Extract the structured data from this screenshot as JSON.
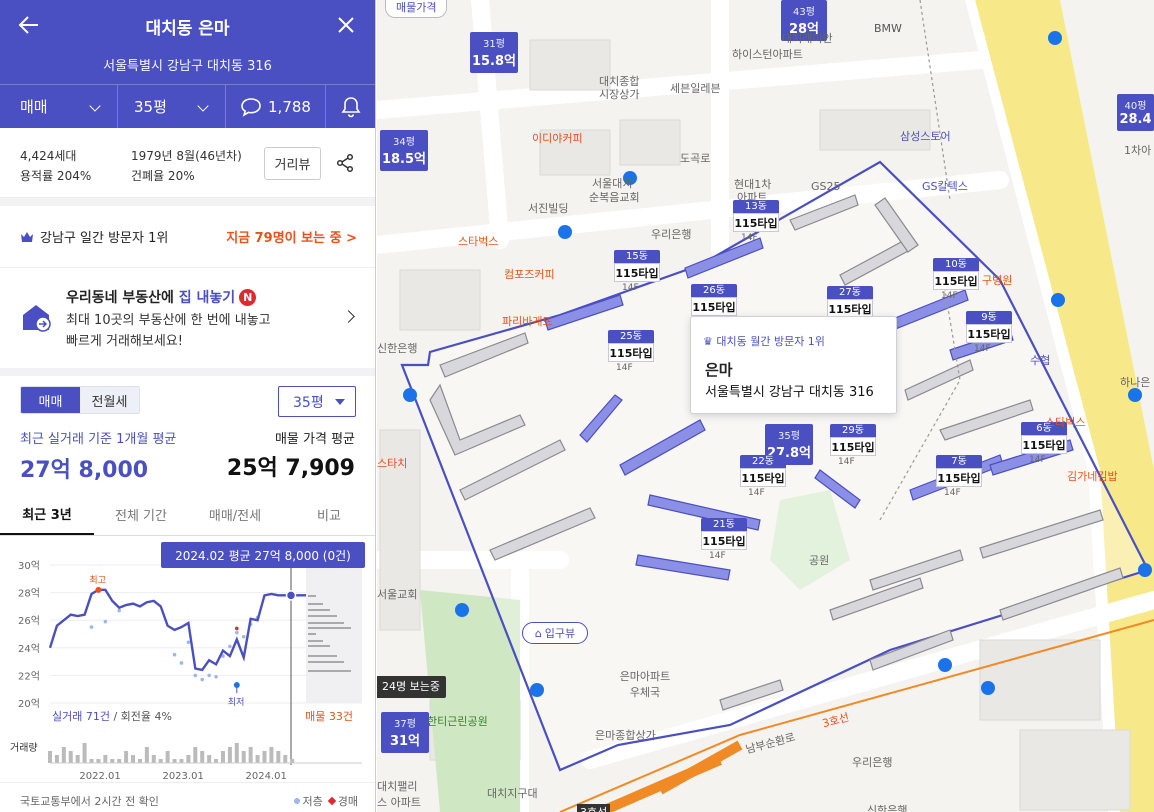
{
  "header": {
    "title": "대치동 은마",
    "address": "서울특별시 강남구 대치동 316",
    "trade_type": "매매",
    "area": "35평",
    "comment_count": "1,788"
  },
  "info": {
    "households": "4,424세대",
    "floor_area_ratio": "용적률 204%",
    "built": "1979년 8월(46년차)",
    "coverage_ratio": "건폐율 20%",
    "street_view": "거리뷰"
  },
  "visit": {
    "rank": "강남구 일간 방문자 1위",
    "now": "지금 79명이 보는 중 >"
  },
  "promo": {
    "title_a": "우리동네 부동산에 ",
    "title_b": "집 내놓기",
    "badge": "N",
    "desc1": "최대 10곳의 부동산에 한 번에 내놓고",
    "desc2": "빠르게 거래해보세요!"
  },
  "trade": {
    "toggle": [
      "매매",
      "전월세"
    ],
    "size": "35평",
    "recent_label": "최근 실거래 기준 1개월 평균",
    "recent_value": "27억 8,000",
    "listing_label": "매물 가격 평균",
    "listing_value": "25억 7,909"
  },
  "tabs": [
    "최근 3년",
    "전체 기간",
    "매매/전세",
    "비교"
  ],
  "chart_tooltip": "2024.02 평균 27억 8,000 (0건)",
  "chart_legend": {
    "deals": "실거래 71건",
    "turnover": " / 회전율 4%",
    "listings": "매물 33건",
    "volume": "거래량",
    "high": "최고",
    "low": "최저"
  },
  "chart_data": {
    "type": "line",
    "ylabel": "",
    "ylim": [
      20,
      30
    ],
    "yticks": [
      "30억",
      "28억",
      "26억",
      "24억",
      "22억",
      "20억"
    ],
    "xticks": [
      "2022.01",
      "2023.01",
      "2024.01"
    ],
    "series": [
      {
        "name": "실거래",
        "x": [
          0,
          1,
          2,
          3,
          4,
          5,
          6,
          7,
          8,
          9,
          10,
          11,
          12,
          13,
          14,
          15,
          16,
          17,
          18,
          19,
          20,
          21,
          22,
          23,
          24,
          25,
          26,
          27,
          28,
          29,
          30,
          31,
          32,
          33,
          34,
          35,
          36,
          37
        ],
        "values": [
          24.0,
          25.6,
          26.0,
          26.4,
          26.3,
          26.4,
          27.9,
          28.2,
          28.2,
          27.4,
          26.9,
          27.1,
          27.2,
          27.0,
          27.3,
          27.4,
          27.0,
          25.6,
          25.3,
          25.5,
          25.8,
          22.5,
          22.4,
          23.1,
          22.8,
          23.8,
          23.4,
          24.6,
          23.3,
          26.1,
          26.0,
          27.8,
          27.9,
          27.8,
          27.8,
          27.8,
          27.8,
          27.8
        ]
      }
    ],
    "high": 28.2,
    "low": 21.3,
    "volume": [
      3,
      2,
      4,
      3,
      2,
      5,
      1,
      1,
      2,
      1,
      1,
      3,
      2,
      1,
      4,
      2,
      1,
      3,
      1,
      1,
      2,
      4,
      3,
      2,
      1,
      3,
      4,
      5,
      3,
      4,
      2,
      3,
      4,
      3,
      2,
      1,
      0,
      0
    ]
  },
  "footer": {
    "source": "국토교통부에서 2시간 전 확인",
    "low_label": "저층",
    "auction_label": "경매"
  },
  "map": {
    "top_button": "매물가격",
    "entry_view": "입구뷰",
    "viewers": "24명 보는중",
    "popup": {
      "rank": "대치동 월간 방문자 1위",
      "name": "은마",
      "address": "서울특별시 강남구 대치동 316"
    },
    "prices": [
      {
        "size": "31평",
        "price": "15.8억"
      },
      {
        "size": "43평",
        "price": "28억"
      },
      {
        "size": "34평",
        "price": "18.5억"
      },
      {
        "size": "40평",
        "price": "28.4"
      },
      {
        "size": "35평",
        "price": "27.8억"
      },
      {
        "size": "37평",
        "price": "31억"
      }
    ],
    "dongs": [
      {
        "dong": "13동",
        "type": "115타입",
        "fl": "14F"
      },
      {
        "dong": "15동",
        "type": "115타입",
        "fl": "14F"
      },
      {
        "dong": "26동",
        "type": "115타입",
        "fl": ""
      },
      {
        "dong": "27동",
        "type": "115타입",
        "fl": ""
      },
      {
        "dong": "10동",
        "type": "115타입",
        "fl": "14F"
      },
      {
        "dong": "9동",
        "type": "115타입",
        "fl": "14F"
      },
      {
        "dong": "25동",
        "type": "115타입",
        "fl": "14F"
      },
      {
        "dong": "29동",
        "type": "115타입",
        "fl": "14F"
      },
      {
        "dong": "22동",
        "type": "115타입",
        "fl": "14F"
      },
      {
        "dong": "6동",
        "type": "115타입",
        "fl": "14F"
      },
      {
        "dong": "7동",
        "type": "115타입",
        "fl": "14F"
      },
      {
        "dong": "21동",
        "type": "115타입",
        "fl": "14F"
      }
    ],
    "labels": {
      "bmw": "BMW",
      "daechi_apt": "대치래미안",
      "hyssen": "하이스턴아파트",
      "market": "대치종합",
      "market2": "시장상가",
      "seven": "세븐일레븐",
      "idea": "이디야커피",
      "samsung": "삼성스토어",
      "church": "서울대치",
      "church2": "순복음교회",
      "hyundai": "현대1차",
      "hyundai2": "아파트",
      "gs25": "GS25",
      "gsmart": "GS칼텍스",
      "seojin": "서진빌딩",
      "woori": "우리은행",
      "starbucks": "스타벅스",
      "compose": "컴포즈커피",
      "paris": "파리바게뜨",
      "shinhan": "신한은행",
      "suhyeop": "수협",
      "hana": "하나은",
      "seoul_church": "서울교회",
      "park": "공원",
      "hanbit": "한티근린공원",
      "daechi_post": "대치지구대",
      "eunma_mall": "은마종합상가",
      "eunma_post": "은마아파트 우체국",
      "hospital": "구병원",
      "road1": "도곡로",
      "road2": "남부순환로",
      "line3": "3호선",
      "palace": "대치팰리스 아파트",
      "gimgane": "김가네김밥",
      "starbucks2": "스타벅스",
      "starbucks3": "스타치",
      "daechi_bank": "대치은행",
      "woori2": "우리은행",
      "shinhan2": "신한은행",
      "line3b": "3호선",
      "apt1": "1차아"
    }
  }
}
